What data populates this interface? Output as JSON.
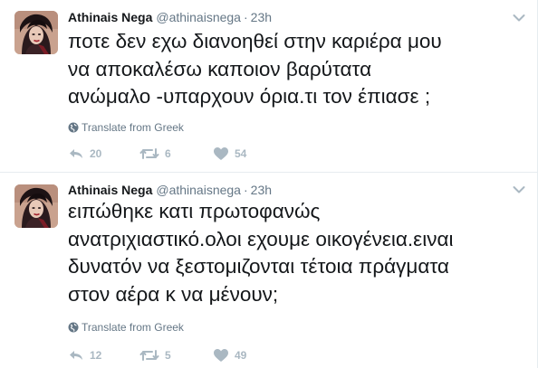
{
  "tweets": [
    {
      "author_name": "Athinais Nega",
      "handle": "@athinaisnega",
      "separator": "·",
      "time": "23h",
      "text": "ποτε δεν εχω διανοηθεί στην καριέρα μου\nνα αποκαλέσω καποιον  βαρύτατα\nανώμαλο -υπαρχουν όρια.τι τον έπιασε ;",
      "translate_label": "Translate from Greek",
      "reply_count": "20",
      "retweet_count": "6",
      "like_count": "54"
    },
    {
      "author_name": "Athinais Nega",
      "handle": "@athinaisnega",
      "separator": "·",
      "time": "23h",
      "text": "ειπώθηκε κατι πρωτοφανώς\nανατριχιαστικό.ολοι εχουμε οικογένεια.ειναι\nδυνατόν να ξεστομιζονται τέτοια πράγματα\nστον αέρα κ να μένουν;",
      "translate_label": "Translate from Greek",
      "reply_count": "12",
      "retweet_count": "5",
      "like_count": "49"
    }
  ],
  "icons": {
    "avatar": "profile-photo",
    "caret": "chevron-down-icon",
    "translate": "globe-icon",
    "reply": "reply-icon",
    "retweet": "retweet-icon",
    "like": "heart-icon"
  },
  "colors": {
    "text": "#14171a",
    "secondary": "#657786",
    "action": "#aab8c2",
    "divider": "#e6ecf0"
  }
}
